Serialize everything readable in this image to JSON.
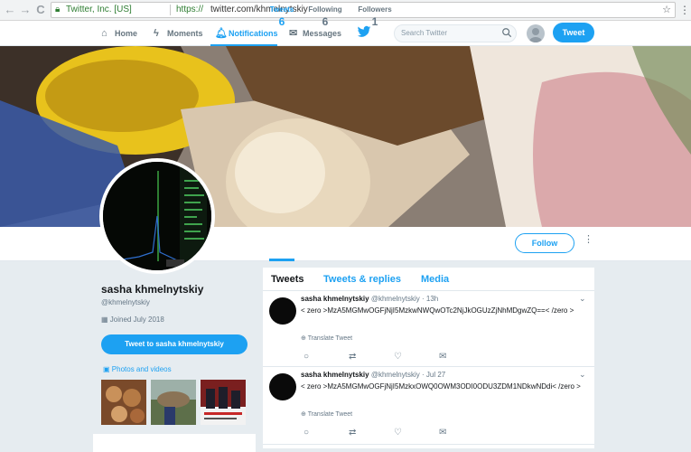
{
  "browser": {
    "nav": {
      "back": "←",
      "forward": "→",
      "reload": "C"
    },
    "secure_label": "Twitter, Inc. [US]",
    "url_protocol": "https://",
    "url_rest": "twitter.com/khmelnytskiy",
    "star": "☆",
    "menu": "⋮"
  },
  "nav": {
    "home": "Home",
    "moments": "Moments",
    "notifications": "Notifications",
    "messages": "Messages",
    "search_placeholder": "Search Twitter",
    "tweet_button": "Tweet"
  },
  "stats": [
    {
      "label": "Tweets",
      "value": "6"
    },
    {
      "label": "Following",
      "value": "6"
    },
    {
      "label": "Followers",
      "value": "1"
    }
  ],
  "follow_button": "Follow",
  "more": "⋮",
  "profile": {
    "name": "sasha khmelnytskiy",
    "handle": "@khmelnytskiy",
    "joined": "Joined July 2018",
    "tweet_to_button": "Tweet to sasha khmelnytskiy",
    "photos_label": "Photos and videos"
  },
  "tabs": [
    "Tweets",
    "Tweets & replies",
    "Media"
  ],
  "tweets": [
    {
      "name": "sasha khmelnytskiy",
      "handle": "@khmelnytskiy",
      "time": "13h",
      "text": "< zero >MzA5MGMwOGFjNjI5MzkwNWQwOTc2NjJkOGUzZjNhMDgwZQ==< /zero >",
      "translate": "Translate Tweet"
    },
    {
      "name": "sasha khmelnytskiy",
      "handle": "@khmelnytskiy",
      "time": "Jul 27",
      "text": "< zero >MzA5MGMwOGFjNjI5MzkxOWQ0OWM3ODI0ODU3ZDM1NDkwNDdi< /zero >",
      "translate": "Translate Tweet"
    }
  ],
  "tweet_actions": {
    "reply": "○",
    "retweet": "⇄",
    "like": "♡",
    "dm": "✉"
  },
  "colors": {
    "accent": "#1da1f2",
    "bg": "#e6ecf0"
  }
}
